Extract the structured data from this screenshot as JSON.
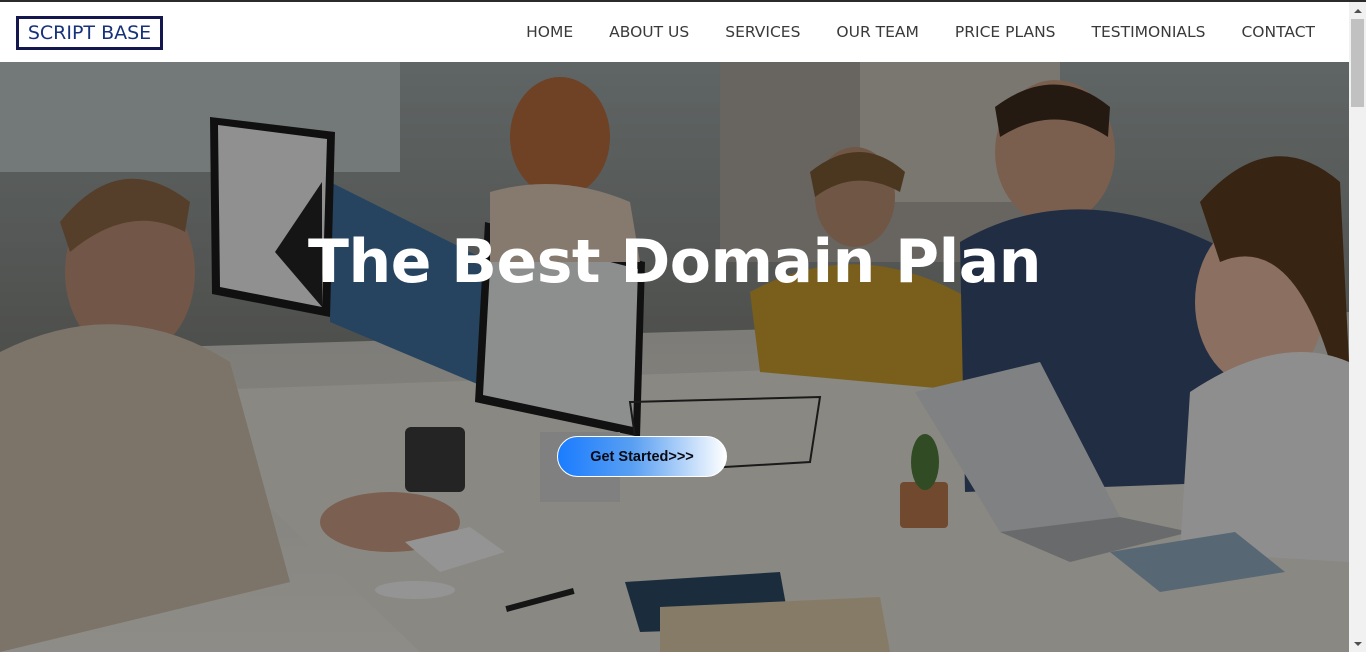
{
  "brand": {
    "logo_text": "SCRIPT BASE"
  },
  "nav": {
    "items": [
      {
        "label": "HOME"
      },
      {
        "label": "ABOUT US"
      },
      {
        "label": "SERVICES"
      },
      {
        "label": "OUR TEAM"
      },
      {
        "label": "PRICE PLANS"
      },
      {
        "label": "TESTIMONIALS"
      },
      {
        "label": "CONTACT"
      }
    ]
  },
  "hero": {
    "title": "The Best Domain Plan",
    "cta_label": "Get Started>>>",
    "background_image": "office-team-at-computers-photo"
  },
  "colors": {
    "logo_border": "#13174e",
    "logo_text": "#16327a",
    "nav_text": "#3a3a3a",
    "cta_gradient_start": "#1a7cff",
    "cta_gradient_end": "#ffffff",
    "hero_title": "#ffffff"
  }
}
